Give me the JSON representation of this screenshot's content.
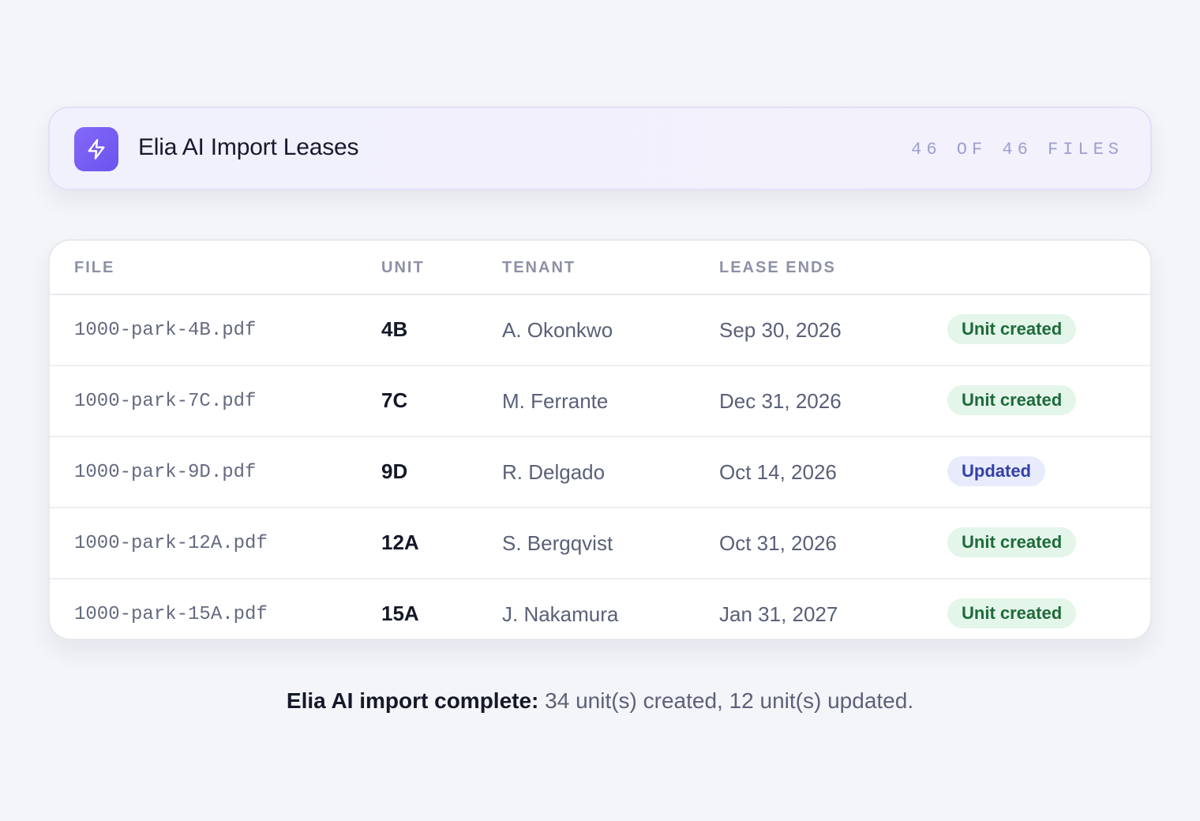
{
  "header": {
    "icon": "lightning-bolt-icon",
    "title": "Elia AI Import Leases",
    "file_count": "46 OF 46 FILES"
  },
  "table": {
    "columns": {
      "file": "FILE",
      "unit": "UNIT",
      "tenant": "TENANT",
      "lease_ends": "LEASE ENDS",
      "status": ""
    },
    "rows": [
      {
        "file": "1000-park-4B.pdf",
        "unit": "4B",
        "tenant": "A. Okonkwo",
        "lease_ends": "Sep 30, 2026",
        "status": "Unit created",
        "status_kind": "created"
      },
      {
        "file": "1000-park-7C.pdf",
        "unit": "7C",
        "tenant": "M. Ferrante",
        "lease_ends": "Dec 31, 2026",
        "status": "Unit created",
        "status_kind": "created"
      },
      {
        "file": "1000-park-9D.pdf",
        "unit": "9D",
        "tenant": "R. Delgado",
        "lease_ends": "Oct 14, 2026",
        "status": "Updated",
        "status_kind": "updated"
      },
      {
        "file": "1000-park-12A.pdf",
        "unit": "12A",
        "tenant": "S. Bergqvist",
        "lease_ends": "Oct 31, 2026",
        "status": "Unit created",
        "status_kind": "created"
      },
      {
        "file": "1000-park-15A.pdf",
        "unit": "15A",
        "tenant": "J. Nakamura",
        "lease_ends": "Jan 31, 2027",
        "status": "Unit created",
        "status_kind": "created"
      }
    ]
  },
  "footer": {
    "label": "Elia AI import complete:",
    "summary": "34 unit(s) created, 12 unit(s) updated."
  },
  "colors": {
    "accent": "#7a5ff5",
    "created_bg": "#e4f5ea",
    "created_text": "#1d6b3a",
    "updated_bg": "#e8ebfb",
    "updated_text": "#3441a6"
  }
}
